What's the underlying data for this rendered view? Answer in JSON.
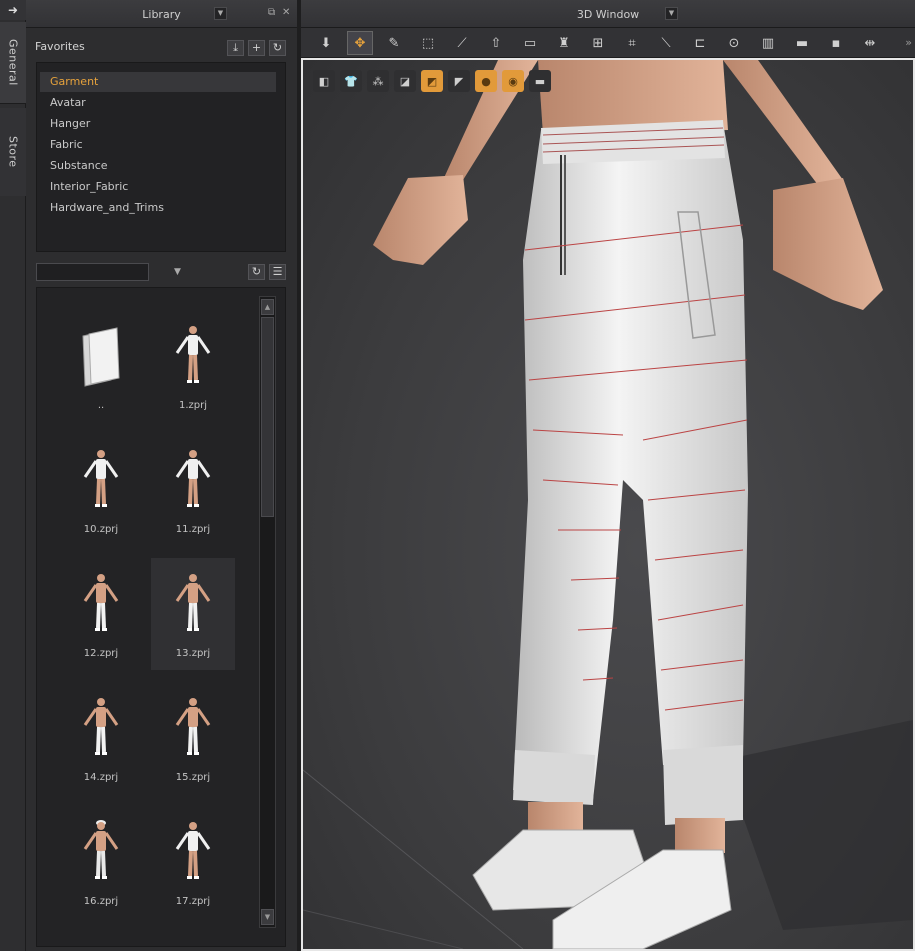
{
  "sidebar_tabs": [
    {
      "label": "General"
    },
    {
      "label": "Store"
    }
  ],
  "library": {
    "title": "Library",
    "favorites": {
      "title": "Favorites",
      "items": [
        {
          "label": "Garment",
          "selected": true
        },
        {
          "label": "Avatar",
          "selected": false
        },
        {
          "label": "Hanger",
          "selected": false
        },
        {
          "label": "Fabric",
          "selected": false
        },
        {
          "label": "Substance",
          "selected": false
        },
        {
          "label": "Interior_Fabric",
          "selected": false
        },
        {
          "label": "Hardware_and_Trims",
          "selected": false
        }
      ]
    },
    "search": {
      "value": "",
      "placeholder": ""
    },
    "files": [
      {
        "name": "..",
        "kind": "folder",
        "selected": false
      },
      {
        "name": "1.zprj",
        "kind": "avatar-white-shirt",
        "selected": false
      },
      {
        "name": "10.zprj",
        "kind": "avatar-white-tank",
        "selected": false
      },
      {
        "name": "11.zprj",
        "kind": "avatar-white-longsleeve",
        "selected": false
      },
      {
        "name": "12.zprj",
        "kind": "avatar-white-pants",
        "selected": false
      },
      {
        "name": "13.zprj",
        "kind": "avatar-white-pants",
        "selected": true
      },
      {
        "name": "14.zprj",
        "kind": "avatar-white-pants",
        "selected": false
      },
      {
        "name": "15.zprj",
        "kind": "avatar-white-pants",
        "selected": false
      },
      {
        "name": "16.zprj",
        "kind": "avatar-hat-shorts",
        "selected": false
      },
      {
        "name": "17.zprj",
        "kind": "avatar-white-jacket",
        "selected": false
      }
    ]
  },
  "window3d": {
    "title": "3D Window",
    "toolbar_icons": [
      "select-move-icon",
      "transform-pattern-icon",
      "fold-arrangement-icon",
      "pin-icon",
      "measure-icon",
      "arrangement-icon",
      "tack-icon",
      "avatar-pose-icon",
      "edit-texture-icon",
      "tape-icon",
      "line-icon",
      "seam-icon",
      "button-icon",
      "zipper-icon",
      "puckering-icon",
      "fold-icon",
      "strengthen-icon",
      "more-arrows-icon"
    ],
    "viewport_icons": [
      {
        "name": "avatar-display-icon",
        "on": false
      },
      {
        "name": "garment-display-icon",
        "on": false
      },
      {
        "name": "particle-display-icon",
        "on": false
      },
      {
        "name": "pose-display-icon",
        "on": false
      },
      {
        "name": "texture-display-icon",
        "on": true
      },
      {
        "name": "shaded-display-icon",
        "on": false
      },
      {
        "name": "skin-display-icon",
        "on": true
      },
      {
        "name": "eye-display-icon",
        "on": true
      },
      {
        "name": "shoe-display-icon",
        "on": false
      }
    ]
  },
  "colors": {
    "accent": "#e6a23c",
    "panel": "#2d2d2f",
    "viewport_border": "#e6e6e6"
  }
}
